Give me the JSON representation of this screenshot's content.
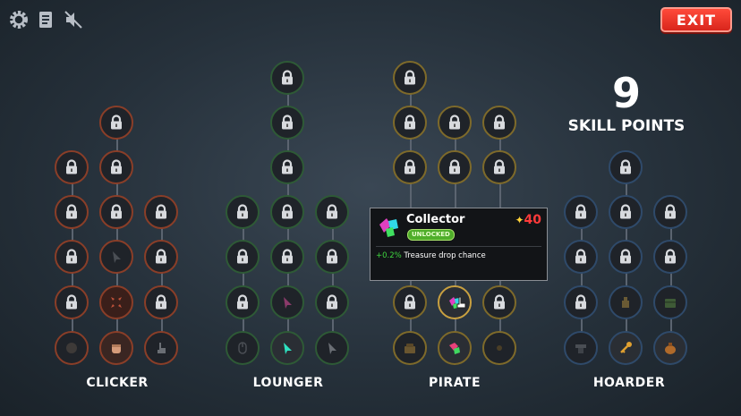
{
  "exit_label": "EXIT",
  "skill_points": {
    "count": "9",
    "label": "SKILL POINTS"
  },
  "top_icons": [
    "gear-icon",
    "notes-icon",
    "sound-muted-icon"
  ],
  "trees": {
    "clicker": {
      "label": "CLICKER",
      "color": "#8a3e28"
    },
    "lounger": {
      "label": "LOUNGER",
      "color": "#2e5a36"
    },
    "pirate": {
      "label": "PIRATE",
      "color": "#7e6a2a"
    },
    "hoarder": {
      "label": "HOARDER",
      "color": "#2f4a6a"
    }
  },
  "tooltip": {
    "title": "Collector",
    "badge": "UNLOCKED",
    "cost_star": "✦",
    "cost": "40",
    "desc_value": "+0.2%",
    "desc_text": " Treasure drop chance"
  }
}
